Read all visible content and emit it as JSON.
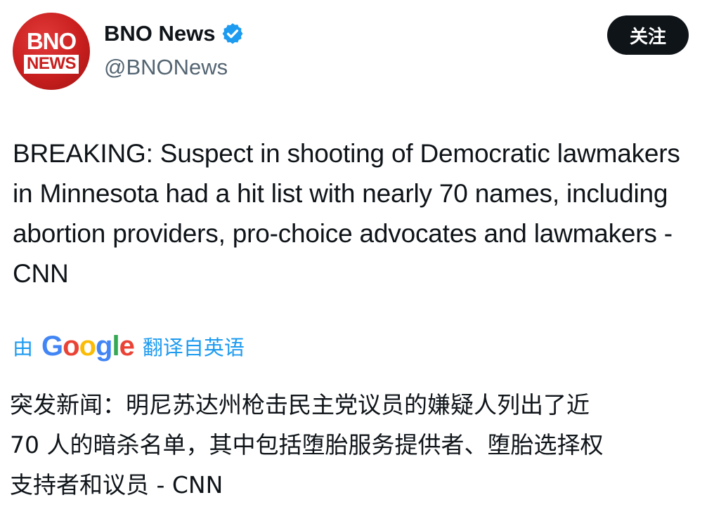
{
  "author": {
    "display_name": "BNO News",
    "handle": "@BNONews",
    "verified_icon": "verified-badge-icon",
    "avatar": {
      "top_text": "BNO",
      "bottom_text": "NEWS"
    }
  },
  "follow_button": {
    "label": "关注"
  },
  "tweet": {
    "text": "BREAKING: Suspect in shooting of Democratic lawmakers in Minnesota had a hit list with nearly 70 names, including abortion providers, pro-choice advocates and lawmakers - CNN"
  },
  "translation": {
    "by_label": "由",
    "provider_logo_letters": [
      "G",
      "o",
      "o",
      "g",
      "l",
      "e"
    ],
    "from_label": "翻译自英语",
    "lines": [
      "突发新闻：明尼苏达州枪击民主党议员的嫌疑人列出了近",
      "70 人的暗杀名单，其中包括堕胎服务提供者、堕胎选择权",
      "支持者和议员 - CNN"
    ]
  },
  "colors": {
    "accent": "#1d9bf0",
    "brand_red": "#c81e1e",
    "text": "#0f1419",
    "secondary_text": "#536471",
    "button_bg": "#0f1419"
  }
}
